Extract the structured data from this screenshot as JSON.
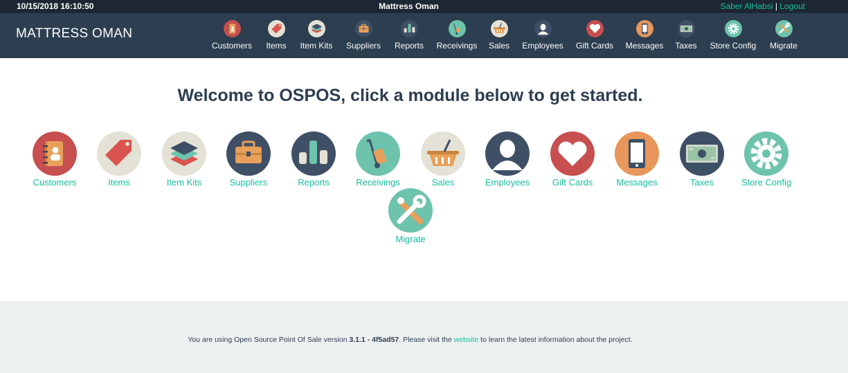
{
  "topbar": {
    "datetime": "10/15/2018 16:10:50",
    "company": "Mattress Oman",
    "user_name": "Saber AlHabsi",
    "separator": "|",
    "logout": "Logout"
  },
  "navbar": {
    "brand": "MATTRESS OMAN",
    "items": [
      {
        "label": "Customers",
        "icon": "customers-icon"
      },
      {
        "label": "Items",
        "icon": "items-icon"
      },
      {
        "label": "Item Kits",
        "icon": "item-kits-icon"
      },
      {
        "label": "Suppliers",
        "icon": "suppliers-icon"
      },
      {
        "label": "Reports",
        "icon": "reports-icon"
      },
      {
        "label": "Receivings",
        "icon": "receivings-icon"
      },
      {
        "label": "Sales",
        "icon": "sales-icon"
      },
      {
        "label": "Employees",
        "icon": "employees-icon"
      },
      {
        "label": "Gift Cards",
        "icon": "gift-cards-icon"
      },
      {
        "label": "Messages",
        "icon": "messages-icon"
      },
      {
        "label": "Taxes",
        "icon": "taxes-icon"
      },
      {
        "label": "Store Config",
        "icon": "store-config-icon"
      },
      {
        "label": "Migrate",
        "icon": "migrate-icon"
      }
    ]
  },
  "main": {
    "welcome": "Welcome to OSPOS, click a module below to get started.",
    "modules": [
      {
        "label": "Customers"
      },
      {
        "label": "Items"
      },
      {
        "label": "Item Kits"
      },
      {
        "label": "Suppliers"
      },
      {
        "label": "Reports"
      },
      {
        "label": "Receivings"
      },
      {
        "label": "Sales"
      },
      {
        "label": "Employees"
      },
      {
        "label": "Gift Cards"
      },
      {
        "label": "Messages"
      },
      {
        "label": "Taxes"
      },
      {
        "label": "Store Config"
      },
      {
        "label": "Migrate"
      }
    ]
  },
  "footer": {
    "text_before": "You are using Open Source Point Of Sale version ",
    "version": "3.1.1 - 4f5ad57",
    "text_middle": ". Please visit the ",
    "link": "website",
    "text_after": " to learn the latest information about the project."
  },
  "colors": {
    "topbar_bg": "#1c2733",
    "navbar_bg": "#2c3e50",
    "accent": "#18bc9c",
    "footer_bg": "#ecf0f1"
  }
}
